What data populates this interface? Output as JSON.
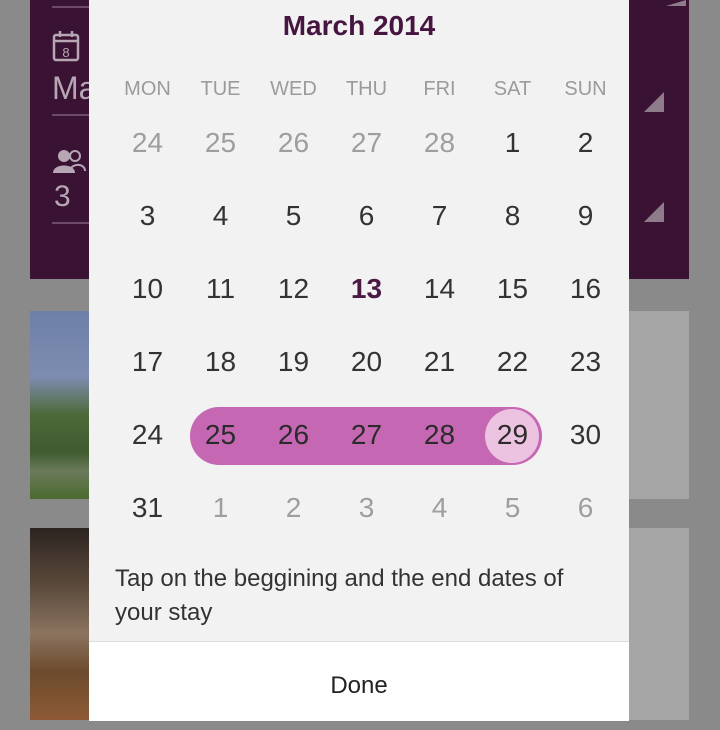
{
  "background": {
    "field_partial_text": "Ma",
    "guests_value": "3"
  },
  "calendar": {
    "title": "March 2014",
    "weekdays": [
      "MON",
      "TUE",
      "WED",
      "THU",
      "FRI",
      "SAT",
      "SUN"
    ],
    "weeks": [
      [
        {
          "d": "24",
          "muted": true
        },
        {
          "d": "25",
          "muted": true
        },
        {
          "d": "26",
          "muted": true
        },
        {
          "d": "27",
          "muted": true
        },
        {
          "d": "28",
          "muted": true
        },
        {
          "d": "1"
        },
        {
          "d": "2"
        }
      ],
      [
        {
          "d": "3"
        },
        {
          "d": "4"
        },
        {
          "d": "5"
        },
        {
          "d": "6"
        },
        {
          "d": "7"
        },
        {
          "d": "8"
        },
        {
          "d": "9"
        }
      ],
      [
        {
          "d": "10"
        },
        {
          "d": "11"
        },
        {
          "d": "12"
        },
        {
          "d": "13",
          "today": true
        },
        {
          "d": "14"
        },
        {
          "d": "15"
        },
        {
          "d": "16"
        }
      ],
      [
        {
          "d": "17"
        },
        {
          "d": "18"
        },
        {
          "d": "19"
        },
        {
          "d": "20"
        },
        {
          "d": "21"
        },
        {
          "d": "22"
        },
        {
          "d": "23"
        }
      ],
      [
        {
          "d": "24"
        },
        {
          "d": "25",
          "range": true
        },
        {
          "d": "26",
          "range": true
        },
        {
          "d": "27",
          "range": true
        },
        {
          "d": "28",
          "range": true
        },
        {
          "d": "29",
          "range": true,
          "rangeEnd": true
        },
        {
          "d": "30"
        }
      ],
      [
        {
          "d": "31"
        },
        {
          "d": "1",
          "muted": true
        },
        {
          "d": "2",
          "muted": true
        },
        {
          "d": "3",
          "muted": true
        },
        {
          "d": "4",
          "muted": true
        },
        {
          "d": "5",
          "muted": true
        },
        {
          "d": "6",
          "muted": true
        }
      ]
    ],
    "selected_range": {
      "start": "25",
      "end": "29"
    },
    "today": "13"
  },
  "hint_text": "Tap on the beggining and the end dates of your stay",
  "done_label": "Done",
  "colors": {
    "accent": "#461640",
    "range_fill": "#c667b4",
    "range_end_fill": "#ecc2e1"
  }
}
